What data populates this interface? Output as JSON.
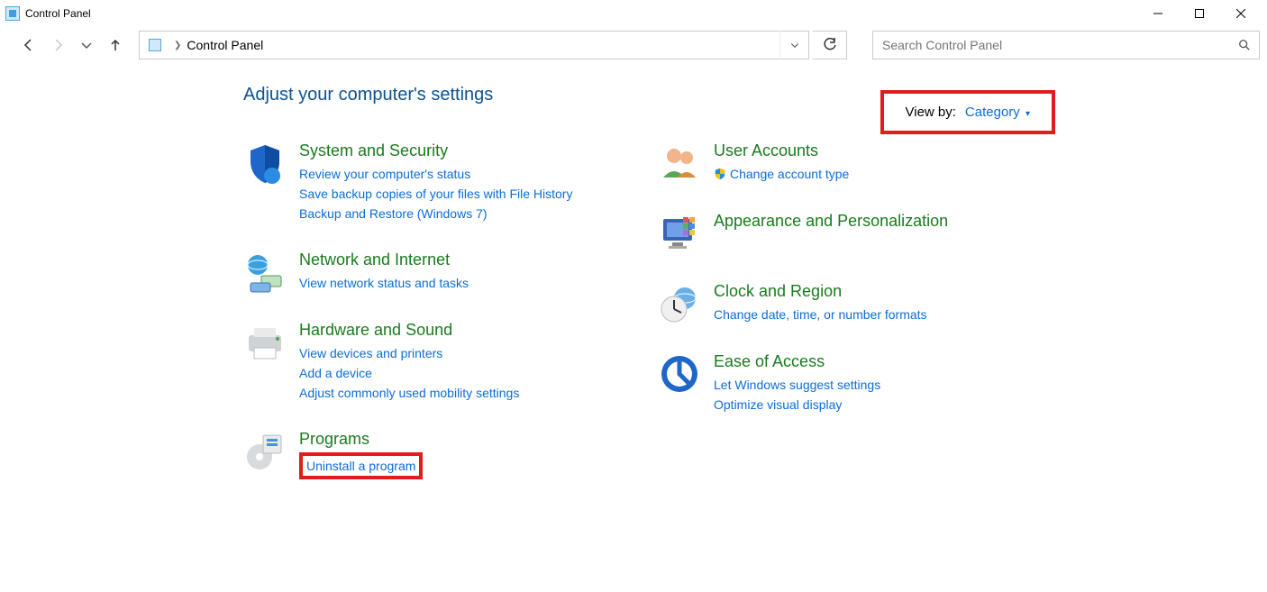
{
  "window": {
    "title": "Control Panel"
  },
  "breadcrumb": {
    "current": "Control Panel"
  },
  "search": {
    "placeholder": "Search Control Panel"
  },
  "heading": "Adjust your computer's settings",
  "viewby": {
    "label": "View by:",
    "value": "Category"
  },
  "left": [
    {
      "title": "System and Security",
      "links": [
        "Review your computer's status",
        "Save backup copies of your files with File History",
        "Backup and Restore (Windows 7)"
      ]
    },
    {
      "title": "Network and Internet",
      "links": [
        "View network status and tasks"
      ]
    },
    {
      "title": "Hardware and Sound",
      "links": [
        "View devices and printers",
        "Add a device",
        "Adjust commonly used mobility settings"
      ]
    },
    {
      "title": "Programs",
      "links": [
        "Uninstall a program"
      ],
      "highlightFirst": true
    }
  ],
  "right": [
    {
      "title": "User Accounts",
      "links": [
        "Change account type"
      ],
      "shieldFirst": true
    },
    {
      "title": "Appearance and Personalization",
      "links": []
    },
    {
      "title": "Clock and Region",
      "links": [
        "Change date, time, or number formats"
      ]
    },
    {
      "title": "Ease of Access",
      "links": [
        "Let Windows suggest settings",
        "Optimize visual display"
      ]
    }
  ]
}
